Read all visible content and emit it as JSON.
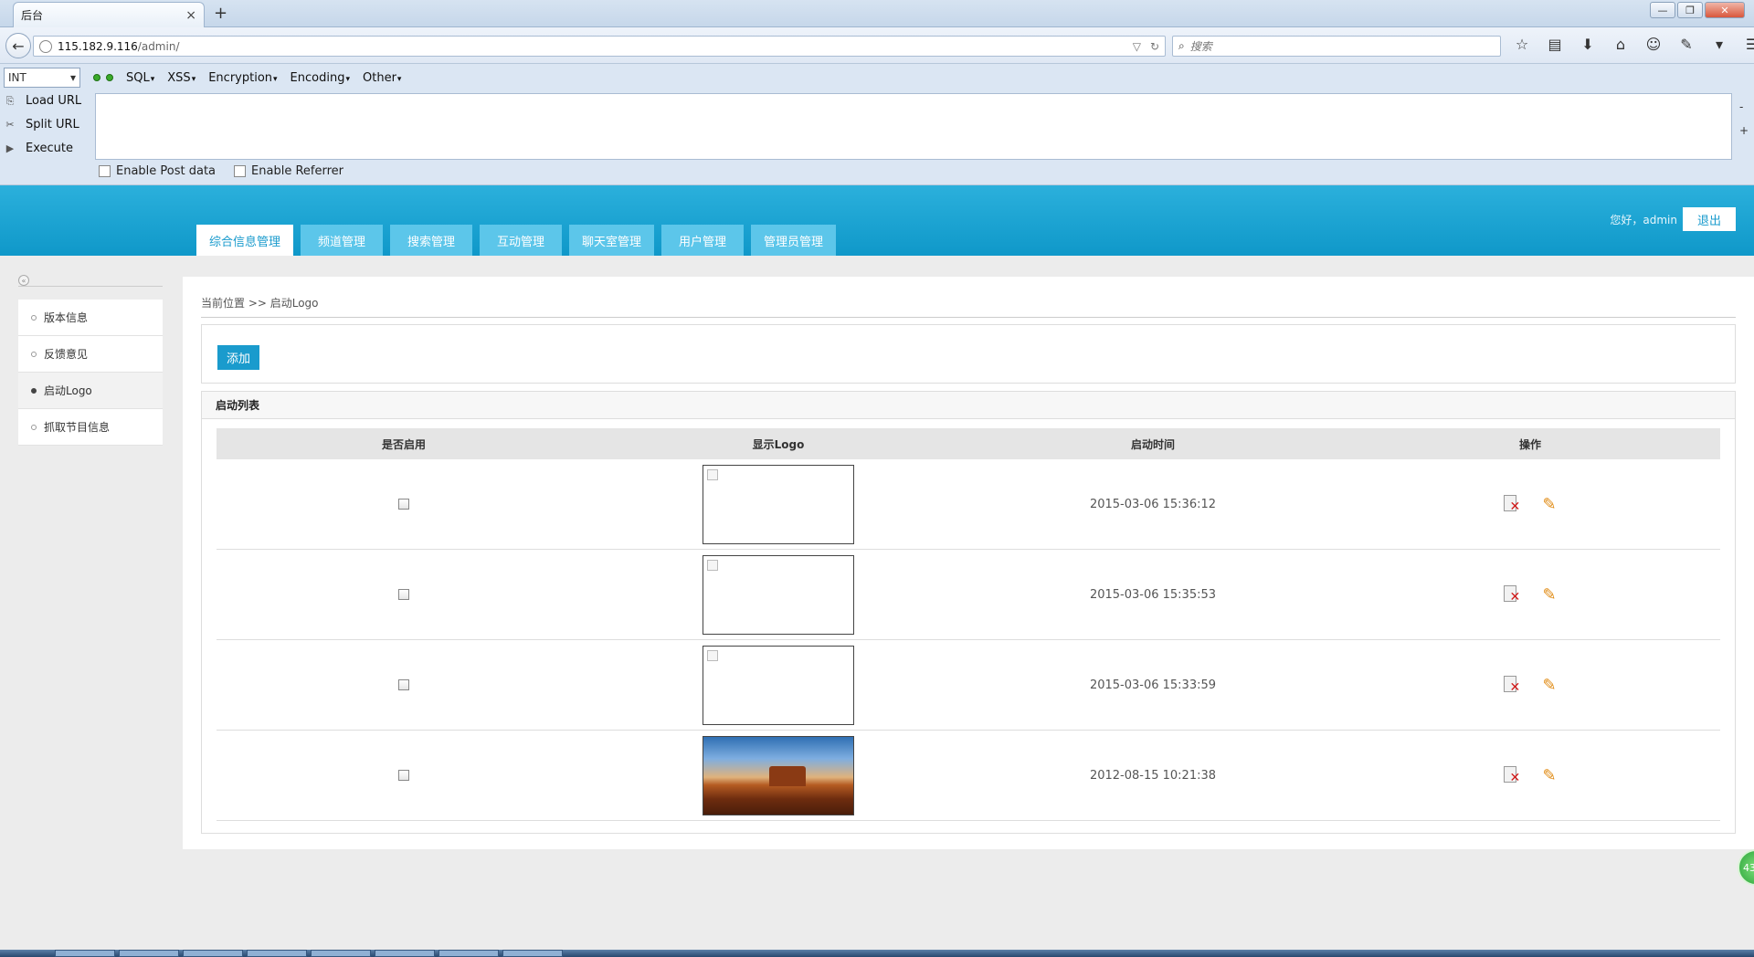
{
  "browser": {
    "tab_title": "后台",
    "tab_close": "×",
    "new_tab": "+",
    "url_host": "115.182.9.116",
    "url_path": "/admin/",
    "search_placeholder": "搜索",
    "icons": [
      "star-icon",
      "reading-list-icon",
      "download-icon",
      "home-icon",
      "chat-icon",
      "extension-icon",
      "dropdown-icon",
      "menu-icon"
    ]
  },
  "hackbar": {
    "select_value": "INT",
    "menus": [
      "SQL",
      "XSS",
      "Encryption",
      "Encoding",
      "Other"
    ],
    "actions": [
      "Load URL",
      "Split URL",
      "Execute"
    ],
    "enable_post": "Enable Post data",
    "enable_referrer": "Enable Referrer",
    "minus": "-",
    "plus": "+"
  },
  "header": {
    "nav": [
      "综合信息管理",
      "频道管理",
      "搜索管理",
      "互动管理",
      "聊天室管理",
      "用户管理",
      "管理员管理"
    ],
    "greeting": "您好，admin",
    "logout": "退出"
  },
  "sidebar": {
    "items": [
      {
        "label": "版本信息",
        "active": false
      },
      {
        "label": "反馈意见",
        "active": false
      },
      {
        "label": "启动Logo",
        "active": true
      },
      {
        "label": "抓取节目信息",
        "active": false
      }
    ]
  },
  "content": {
    "breadcrumb": "当前位置 >> 启动Logo",
    "add_button": "添加",
    "list_title": "启动列表",
    "columns": [
      "是否启用",
      "显示Logo",
      "启动时间",
      "操作"
    ],
    "rows": [
      {
        "enabled": false,
        "logo": "broken",
        "time": "2015-03-06 15:36:12"
      },
      {
        "enabled": false,
        "logo": "broken",
        "time": "2015-03-06 15:35:53"
      },
      {
        "enabled": false,
        "logo": "broken",
        "time": "2015-03-06 15:33:59"
      },
      {
        "enabled": false,
        "logo": "photo",
        "time": "2012-08-15 10:21:38"
      }
    ]
  },
  "widget": {
    "badge": "43"
  },
  "colors": {
    "brand": "#1a9bcd",
    "nav_bg": "#5cc6ea",
    "delete": "#d21a1a",
    "edit": "#e08a12"
  }
}
